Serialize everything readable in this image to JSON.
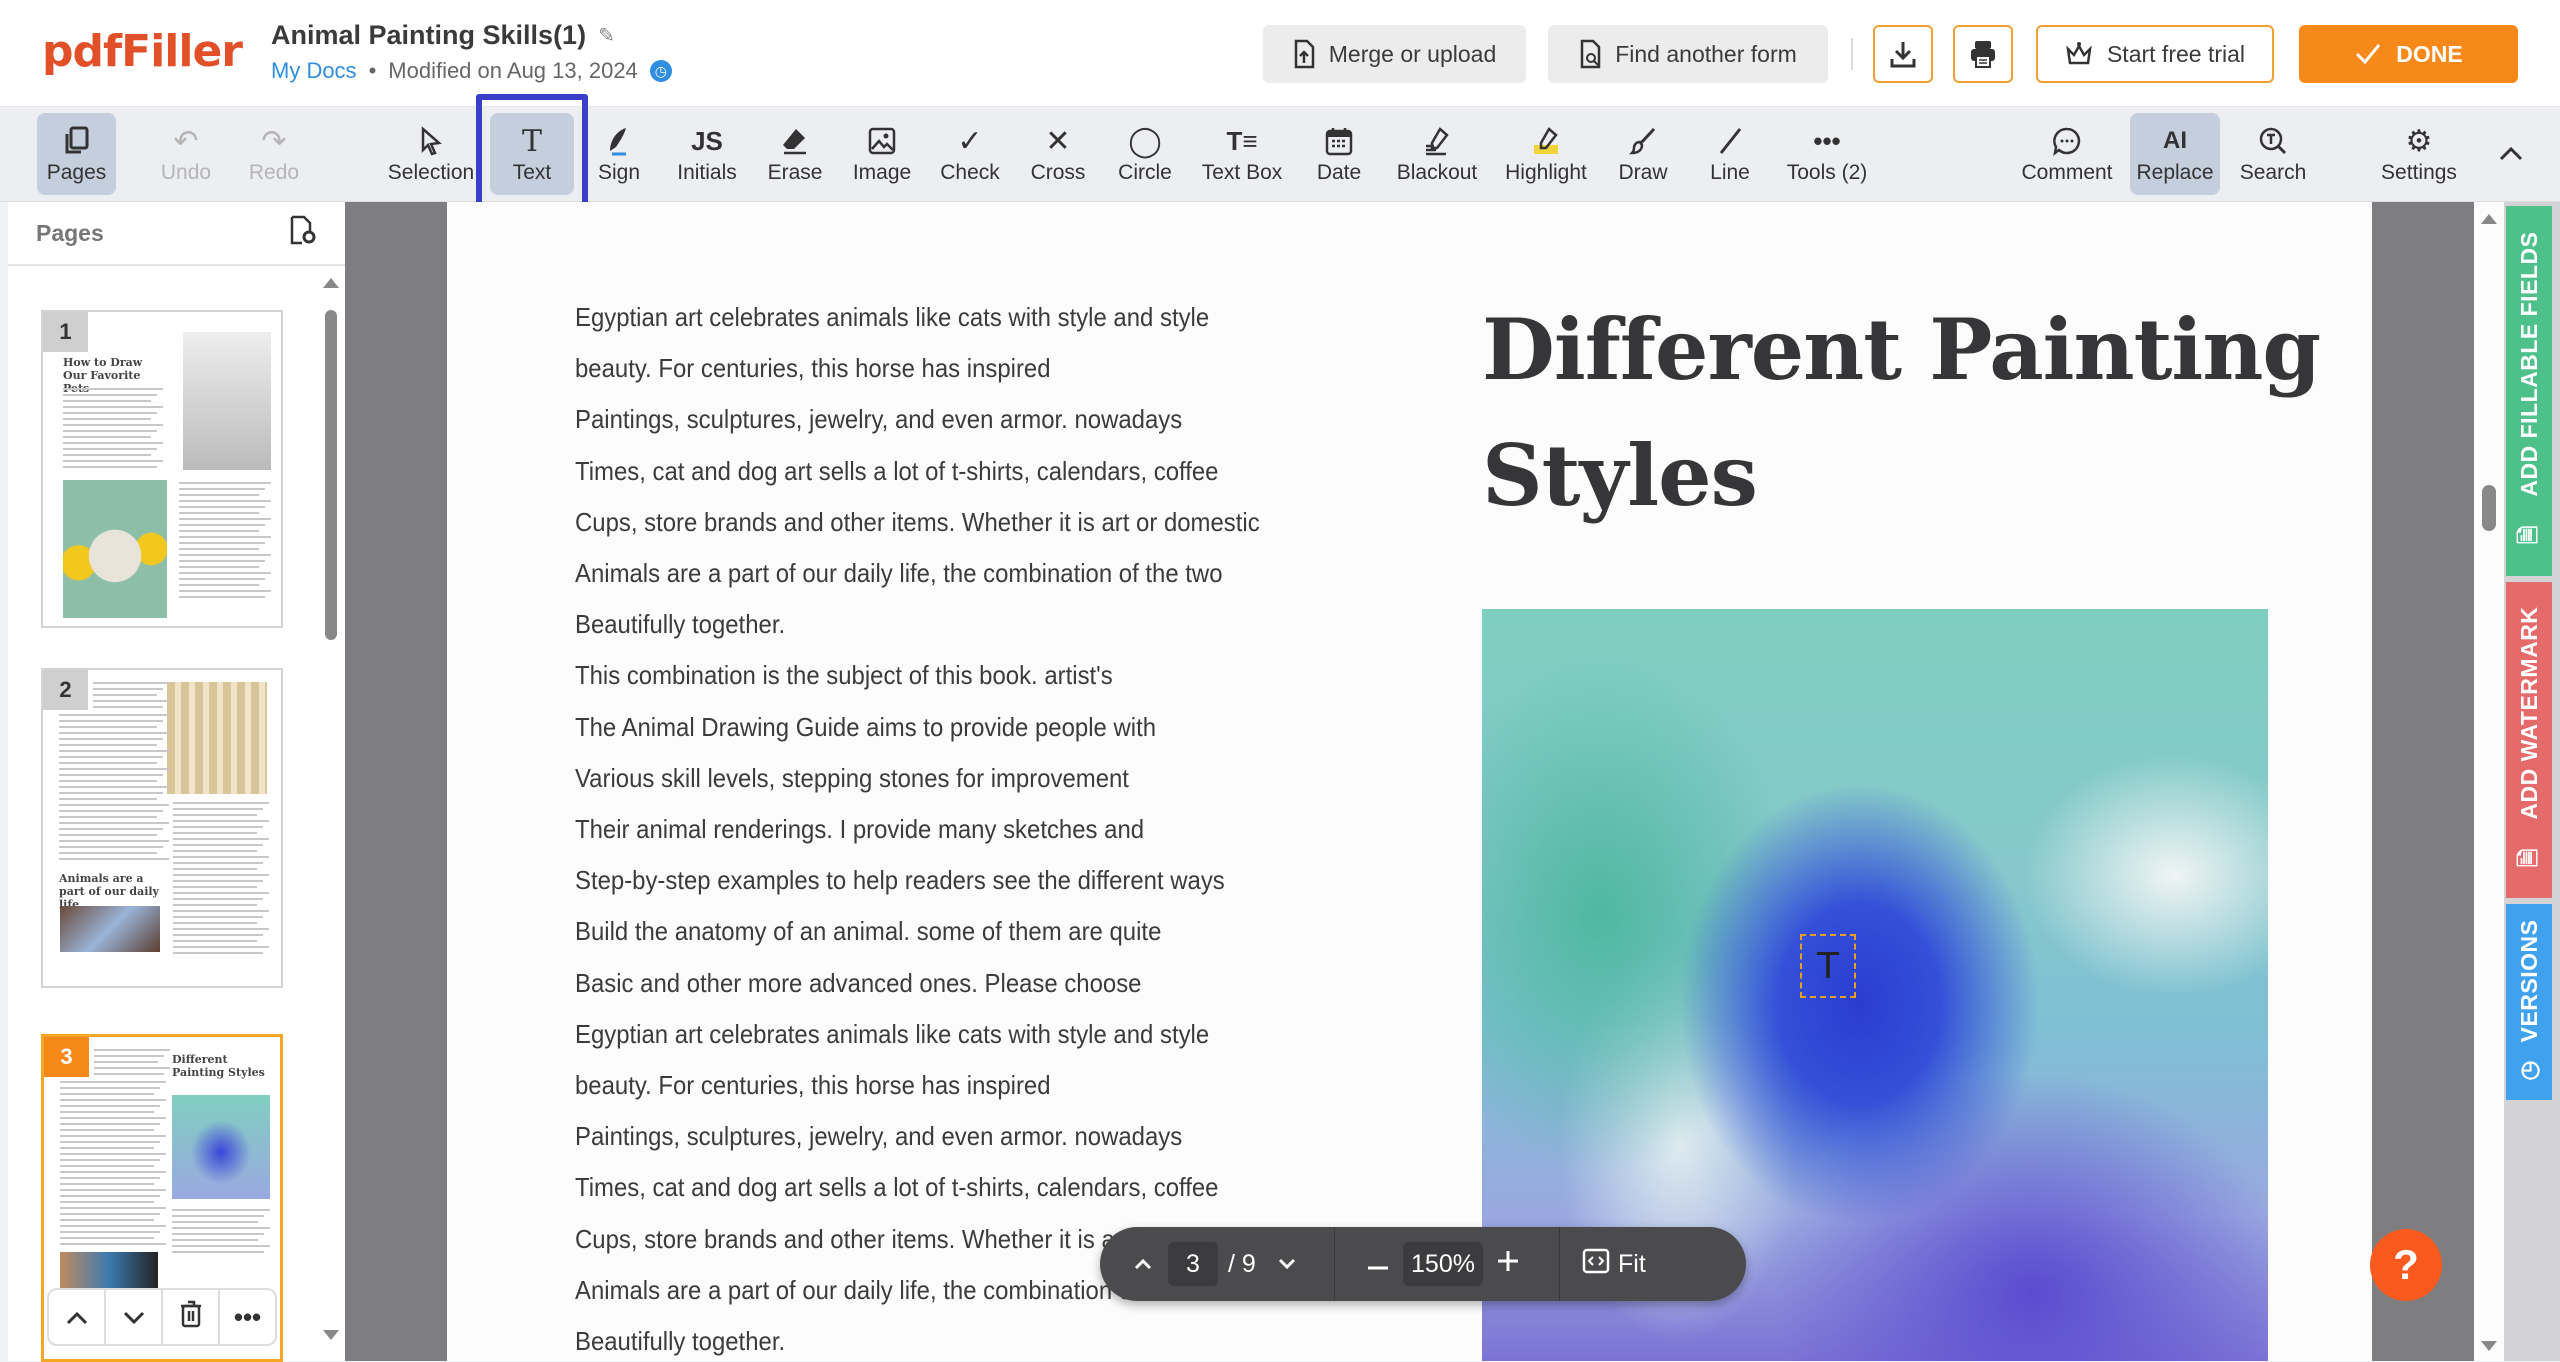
{
  "app": {
    "logo": "pdfFiller",
    "doc_title": "Animal Painting Skills(1)",
    "breadcrumb_link": "My Docs",
    "modified": "Modified on Aug 13, 2024",
    "brand_color": "#e2502a",
    "accent_color": "#f7891a"
  },
  "header": {
    "merge_label": "Merge or upload",
    "find_label": "Find another form",
    "trial_label": "Start free trial",
    "done_label": "DONE"
  },
  "toolbar": {
    "items": [
      {
        "label": "Pages",
        "icon": "pages-icon",
        "state": "active"
      },
      {
        "label": "Undo",
        "icon": "undo-icon",
        "state": "disabled"
      },
      {
        "label": "Redo",
        "icon": "redo-icon",
        "state": "disabled"
      },
      {
        "label": "Selection",
        "icon": "cursor-icon"
      },
      {
        "label": "Text",
        "icon": "text-icon",
        "state": "active"
      },
      {
        "label": "Sign",
        "icon": "sign-icon"
      },
      {
        "label": "Initials",
        "icon": "initials-icon"
      },
      {
        "label": "Erase",
        "icon": "eraser-icon"
      },
      {
        "label": "Image",
        "icon": "image-icon"
      },
      {
        "label": "Check",
        "icon": "check-icon"
      },
      {
        "label": "Cross",
        "icon": "cross-icon"
      },
      {
        "label": "Circle",
        "icon": "circle-icon"
      },
      {
        "label": "Text Box",
        "icon": "text-box-icon"
      },
      {
        "label": "Date",
        "icon": "calendar-icon"
      },
      {
        "label": "Blackout",
        "icon": "blackout-icon"
      },
      {
        "label": "Highlight",
        "icon": "highlight-icon"
      },
      {
        "label": "Draw",
        "icon": "brush-icon"
      },
      {
        "label": "Line",
        "icon": "line-icon"
      },
      {
        "label": "Tools (2)",
        "icon": "more-icon"
      },
      {
        "label": "Comment",
        "icon": "comment-icon"
      },
      {
        "label": "Replace",
        "icon": "replace-icon",
        "state": "active"
      },
      {
        "label": "Search",
        "icon": "search-icon"
      },
      {
        "label": "Settings",
        "icon": "gear-icon"
      }
    ]
  },
  "pages_panel": {
    "title": "Pages",
    "thumbs": [
      {
        "num": "1",
        "heading": "How to Draw Our Favorite Pets"
      },
      {
        "num": "2",
        "heading": "Animals are a part of our daily life"
      },
      {
        "num": "3",
        "heading": "Different Painting Styles",
        "current": true
      }
    ]
  },
  "document": {
    "heading_line1": "Different Painting",
    "heading_line2": "Styles",
    "text_cursor_glyph": "T",
    "lines": [
      "Egyptian art celebrates animals like cats with style and style",
      "beauty. For centuries, this horse has inspired",
      "Paintings, sculptures, jewelry, and even armor. nowadays",
      "Times, cat and dog art sells a lot of t-shirts, calendars, coffee",
      "Cups, store brands and other items. Whether it is art or domestic",
      "Animals are a part of our daily life, the combination of the two",
      "Beautifully together.",
      "This combination is the subject of this book. artist's",
      "The Animal Drawing Guide aims to provide people with",
      "Various skill levels, stepping stones for improvement",
      "Their animal renderings. I provide many sketches and",
      "Step-by-step examples to help readers see the different ways",
      "Build the anatomy of an animal. some of them are quite",
      "Basic and other more advanced ones. Please choose",
      "Egyptian art celebrates animals like cats with style and style",
      "beauty. For centuries, this horse has inspired",
      "Paintings, sculptures, jewelry, and even armor. nowadays",
      "Times, cat and dog art sells a lot of t-shirts, calendars, coffee",
      "Cups, store brands and other items. Whether it is art or domestic",
      "Animals are a part of our daily life, the combination of the two",
      "Beautifully together."
    ]
  },
  "navigator": {
    "current_page": "3",
    "total_pages": "/ 9",
    "zoom": "150%",
    "fit_label": "Fit"
  },
  "side_tabs": {
    "fillable": "ADD FILLABLE FIELDS",
    "watermark": "ADD WATERMARK",
    "versions": "VERSIONS"
  },
  "help": {
    "label": "?"
  }
}
